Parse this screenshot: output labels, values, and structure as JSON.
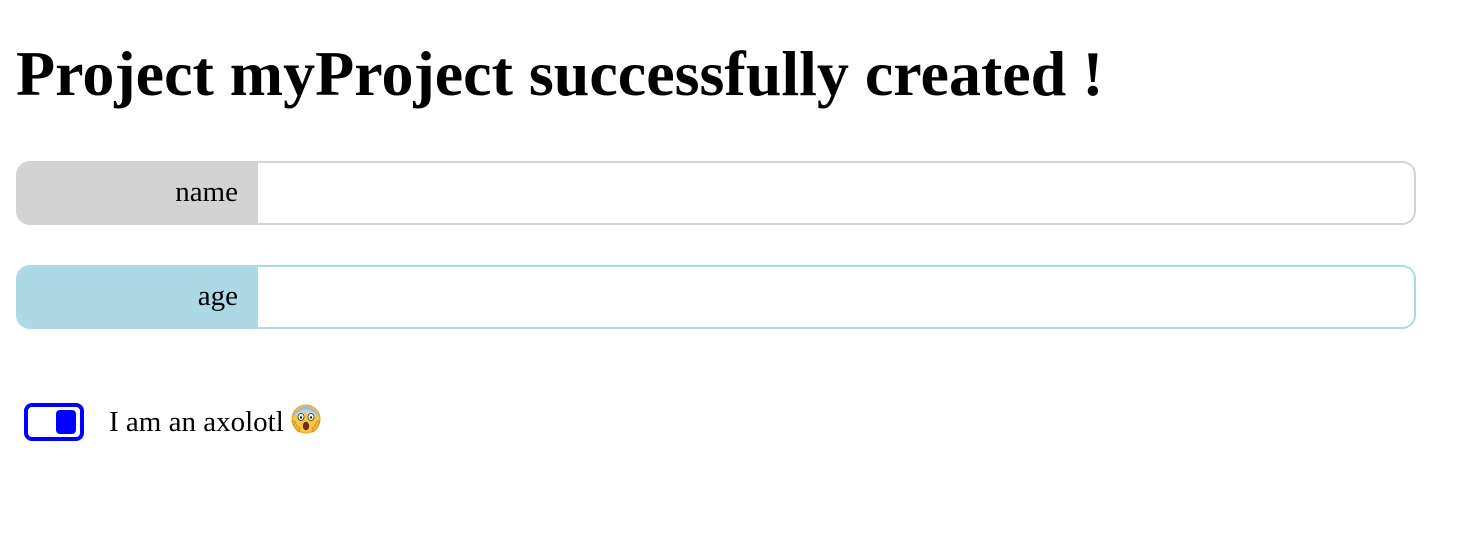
{
  "header": {
    "title": "Project myProject successfully created !"
  },
  "form": {
    "fields": [
      {
        "label": "name",
        "value": "",
        "placeholder": "",
        "accent": "#d3d3d3"
      },
      {
        "label": "age",
        "value": "",
        "placeholder": "",
        "accent": "#add8e6"
      }
    ],
    "toggle": {
      "label": "I am an axolotl",
      "checked": true,
      "accent": "#0000ff",
      "emoji_icon": "screaming-face-icon"
    }
  }
}
